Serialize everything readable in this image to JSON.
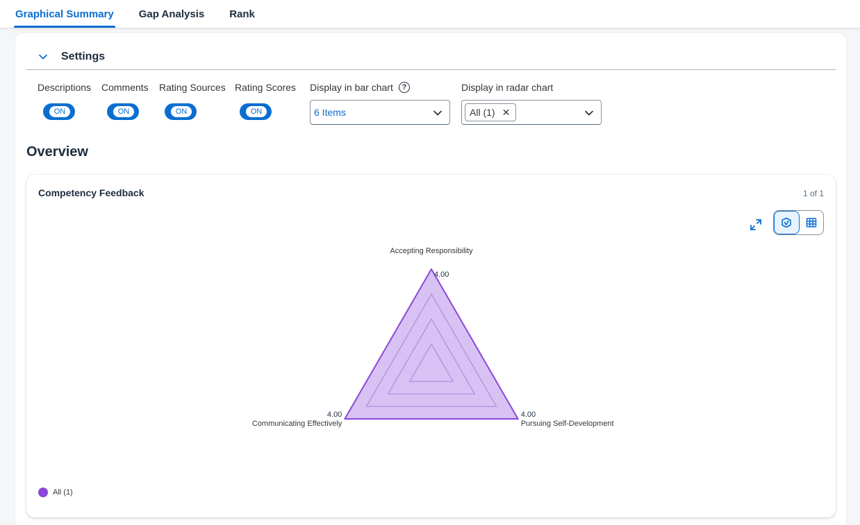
{
  "tabs": [
    {
      "label": "Graphical Summary",
      "active": true
    },
    {
      "label": "Gap Analysis",
      "active": false
    },
    {
      "label": "Rank",
      "active": false
    }
  ],
  "settings": {
    "title": "Settings",
    "toggles": [
      {
        "label": "Descriptions",
        "state": "ON"
      },
      {
        "label": "Comments",
        "state": "ON"
      },
      {
        "label": "Rating Sources",
        "state": "ON"
      },
      {
        "label": "Rating Scores",
        "state": "ON"
      }
    ],
    "bar_chart": {
      "label": "Display in bar chart",
      "help_icon": "question-circle-icon",
      "value": "6 Items"
    },
    "radar_chart": {
      "label": "Display in radar chart",
      "token": "All (1)"
    }
  },
  "overview": {
    "title": "Overview",
    "chart_card": {
      "title": "Competency Feedback",
      "pager": "1 of 1",
      "legend_label": "All (1)"
    }
  },
  "colors": {
    "accent": "#0a6ed1",
    "series_stroke": "#8b47d7",
    "series_fill": "#d8c1f3",
    "legend_dot": "#8b47d7"
  },
  "chart_data": {
    "type": "radar",
    "categories": [
      "Accepting Responsibility",
      "Pursuing Self-Development",
      "Communicating Effectively"
    ],
    "series": [
      {
        "name": "All (1)",
        "values": [
          4.0,
          4.0,
          4.0
        ],
        "labels": [
          "4.00",
          "4.00",
          "4.00"
        ]
      }
    ],
    "rmax": 4,
    "rings": 4
  }
}
